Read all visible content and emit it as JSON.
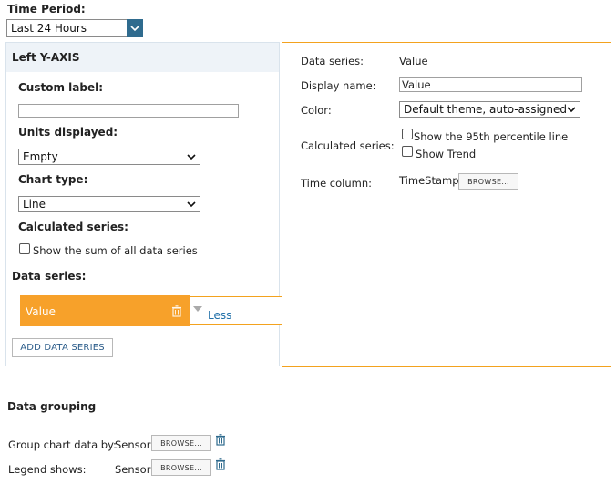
{
  "time_period": {
    "label": "Time Period:",
    "selected": "Last 24 Hours"
  },
  "left_axis": {
    "header": "Left Y-AXIS",
    "custom_label": {
      "label": "Custom label:",
      "value": ""
    },
    "units": {
      "label": "Units displayed:",
      "selected": "Empty"
    },
    "chart_type": {
      "label": "Chart type:",
      "selected": "Line"
    },
    "calculated_series": {
      "label": "Calculated series:",
      "sum_checkbox_label": "Show the sum of all data series",
      "sum_checked": false
    },
    "data_series": {
      "label": "Data series:",
      "items": [
        {
          "name": "Value",
          "toggle_label": "Less"
        }
      ],
      "add_button": "ADD DATA SERIES"
    }
  },
  "series_details": {
    "data_series": {
      "label": "Data series:",
      "value": "Value"
    },
    "display_name": {
      "label": "Display name:",
      "value": "Value"
    },
    "color": {
      "label": "Color:",
      "selected": "Default theme, auto-assigned"
    },
    "calculated_series": {
      "label": "Calculated series:",
      "options": [
        {
          "label": "Show the 95th percentile line",
          "checked": false
        },
        {
          "label": "Show Trend",
          "checked": false
        }
      ]
    },
    "time_column": {
      "label": "Time column:",
      "value": "TimeStamp",
      "browse": "BROWSE..."
    }
  },
  "data_grouping": {
    "title": "Data grouping",
    "group_by": {
      "label": "Group chart data by:",
      "value": "Sensor",
      "browse": "BROWSE..."
    },
    "legend": {
      "label": "Legend shows:",
      "value": "Sensor",
      "browse": "BROWSE..."
    }
  },
  "colors": {
    "accent_orange": "#f7a12a",
    "panel_border_orange": "#f3a21e",
    "dropdown_blue": "#2f6b8e",
    "link_blue": "#1f6fa8",
    "header_bg": "#eef3f8"
  }
}
